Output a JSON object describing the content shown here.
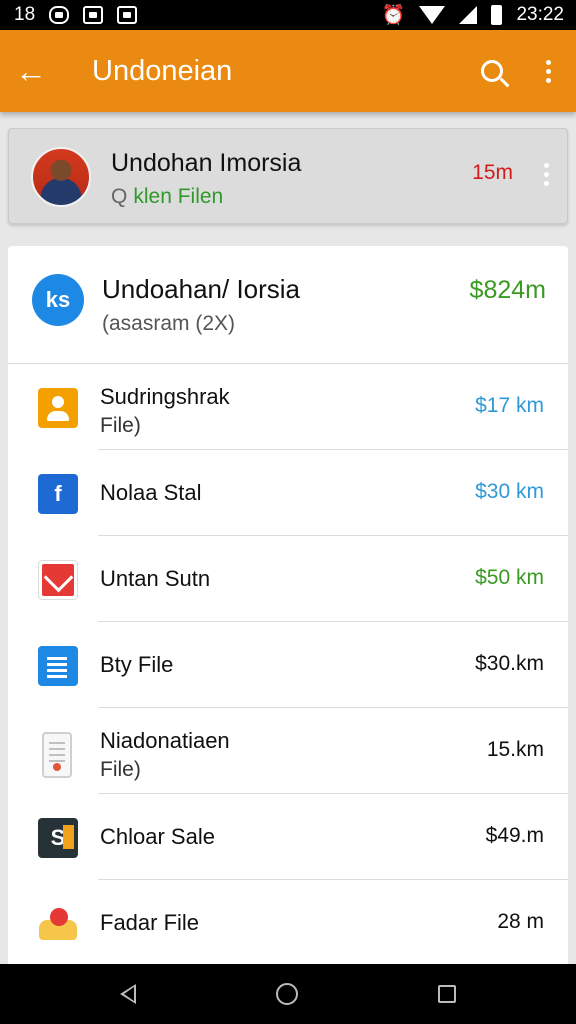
{
  "status_bar": {
    "left_text": "18",
    "time": "23:22"
  },
  "app_bar": {
    "title": "Undoneian"
  },
  "account": {
    "name": "Undohan Imorsia",
    "subtitle_prefix": "Q",
    "subtitle": "klen Filen",
    "amount": "15m"
  },
  "summary": {
    "icon_text": "ks",
    "title": "Undoahan/ Iorsia",
    "subtitle": "(asasram (2X)",
    "amount": "$824m"
  },
  "items": [
    {
      "icon": "user-icon",
      "line1": "Sudringshrak",
      "line2": "File)",
      "amount": "$17 km",
      "amount_color": "#2f9ad8"
    },
    {
      "icon": "facebook-icon",
      "line1": "Nolaa Stal",
      "line2": "",
      "amount": "$30 km",
      "amount_color": "#2f9ad8"
    },
    {
      "icon": "mail-icon",
      "line1": "Untan Sutn",
      "line2": "",
      "amount": "$50 km",
      "amount_color": "#3a9a22"
    },
    {
      "icon": "document-icon",
      "line1": "Bty File",
      "line2": "",
      "amount": "$30.km",
      "amount_color": "#111111"
    },
    {
      "icon": "page-icon",
      "line1": "Niadonatiaen",
      "line2": "File)",
      "amount": "15.km",
      "amount_color": "#111111"
    },
    {
      "icon": "terminal-icon",
      "line1": "Chloar Sale",
      "line2": "",
      "amount": "$49.m",
      "amount_color": "#111111"
    },
    {
      "icon": "folder-icon",
      "line1": "Fadar File",
      "line2": "",
      "amount": "28 m",
      "amount_color": "#111111"
    }
  ],
  "colors": {
    "app_bar": "#ea8a10",
    "status_bar": "#000000",
    "positive": "#3a9a22",
    "negative": "#d11c1c",
    "link": "#2f9ad8"
  }
}
